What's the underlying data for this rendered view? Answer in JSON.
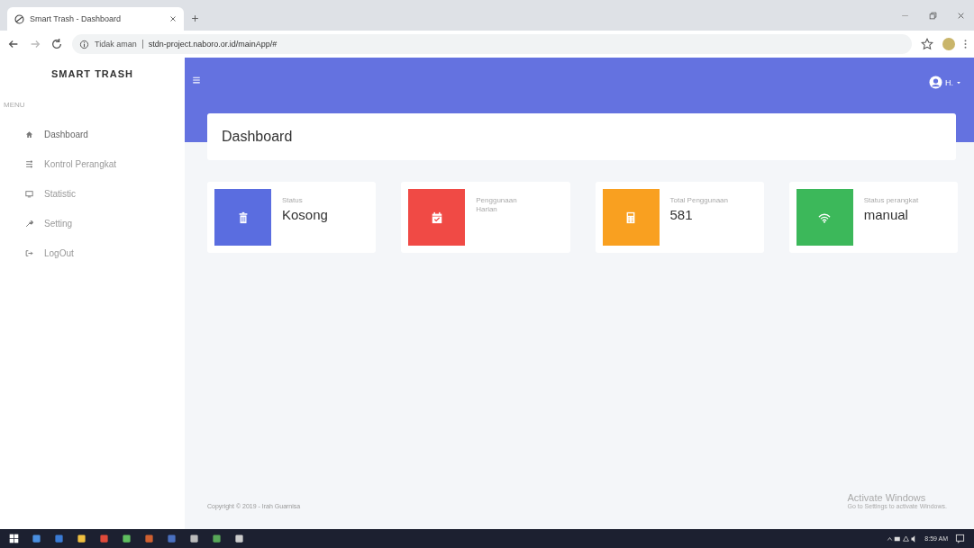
{
  "browser": {
    "tab_title": "Smart Trash - Dashboard",
    "security": "Tidak aman",
    "url": "stdn-project.naboro.or.id/mainApp/#"
  },
  "sidebar": {
    "brand": "SMART TRASH",
    "section": "MENU",
    "items": [
      {
        "label": "Dashboard",
        "selected": true
      },
      {
        "label": "Kontrol Perangkat",
        "selected": false
      },
      {
        "label": "Statistic",
        "selected": false
      },
      {
        "label": "Setting",
        "selected": false
      },
      {
        "label": "LogOut",
        "selected": false
      }
    ]
  },
  "topbar": {
    "user": "H."
  },
  "page_title": "Dashboard",
  "cards": [
    {
      "label": "Status",
      "value": "Kosong",
      "color": "#5a6de0"
    },
    {
      "label": "Penggunaan Harian",
      "color": "#f04a45"
    },
    {
      "label": "Total Penggunaan",
      "value": "581",
      "color": "#f9a020"
    },
    {
      "label": "Status perangkat",
      "value": "manual",
      "color": "#3cb85a"
    }
  ],
  "footer": "Copyright © 2019 - Irah Guarnisa",
  "watermark": {
    "title": "Activate Windows",
    "hint": "Go to Settings to activate Windows."
  },
  "taskbar": {
    "clock": "8:59 AM"
  }
}
